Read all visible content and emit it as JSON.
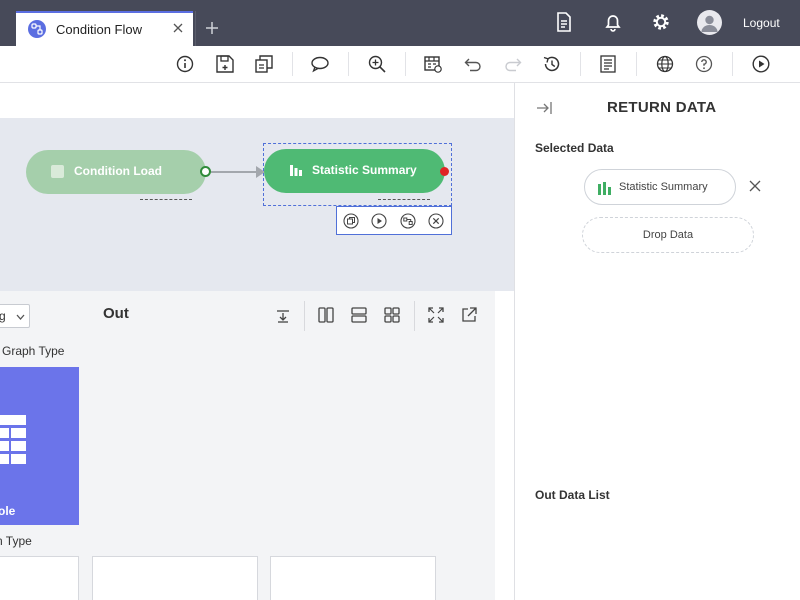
{
  "tab": {
    "title": "Condition Flow",
    "icon": "flow-icon"
  },
  "header": {
    "icons": [
      "document-icon",
      "bell-icon",
      "gear-icon",
      "user-avatar-icon"
    ],
    "logout_label": "Logout",
    "background": "#474a59",
    "accent": "#5b6ee1"
  },
  "toolbar": {
    "tools": [
      "info-icon",
      "save-icon",
      "copy-icon",
      "comment-icon",
      "zoom-in-icon",
      "calendar-icon",
      "undo-icon",
      "redo-icon",
      "history-icon",
      "list-icon",
      "globe-icon",
      "help-icon",
      "run-icon"
    ]
  },
  "canvas": {
    "nodes": [
      {
        "label": "Condition Load",
        "color": "#a5cfab",
        "state": "inactive"
      },
      {
        "label": "Statistic Summary",
        "color": "#4fba74",
        "state": "selected"
      }
    ],
    "node_actions": [
      "copy-icon",
      "play-icon",
      "connect-icon",
      "delete-icon"
    ]
  },
  "out_panel": {
    "dropdown_value": "g",
    "title": "Out",
    "graph_type_label": "Graph Type",
    "selected_graph_type": "ole",
    "second_type_label": "n Type",
    "card_color": "#6b74ea"
  },
  "right_panel": {
    "title": "RETURN DATA",
    "selected_data_label": "Selected Data",
    "selected_chip": "Statistic Summary",
    "drop_zone": "Drop Data",
    "out_data_list_label": "Out Data List"
  }
}
